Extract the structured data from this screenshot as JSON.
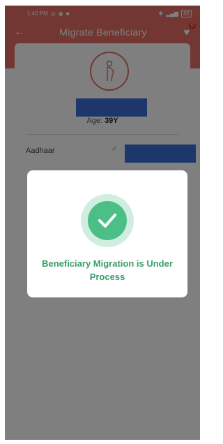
{
  "status_bar": {
    "time": "1:40 PM",
    "battery": "88"
  },
  "app_bar": {
    "back_icon": "arrow-left-icon",
    "title": "Migrate Beneficiary",
    "badge_count": "0"
  },
  "profile": {
    "age_label": "Age:",
    "age_value": "39Y"
  },
  "fields": {
    "aadhaar_label": "Aadhaar"
  },
  "dialog": {
    "message": "Beneficiary Migration is Under Process"
  },
  "colors": {
    "header": "#e46f64",
    "success": "#4cbf86",
    "success_text": "#3a9d6a",
    "redaction": "#3b6fd8"
  }
}
